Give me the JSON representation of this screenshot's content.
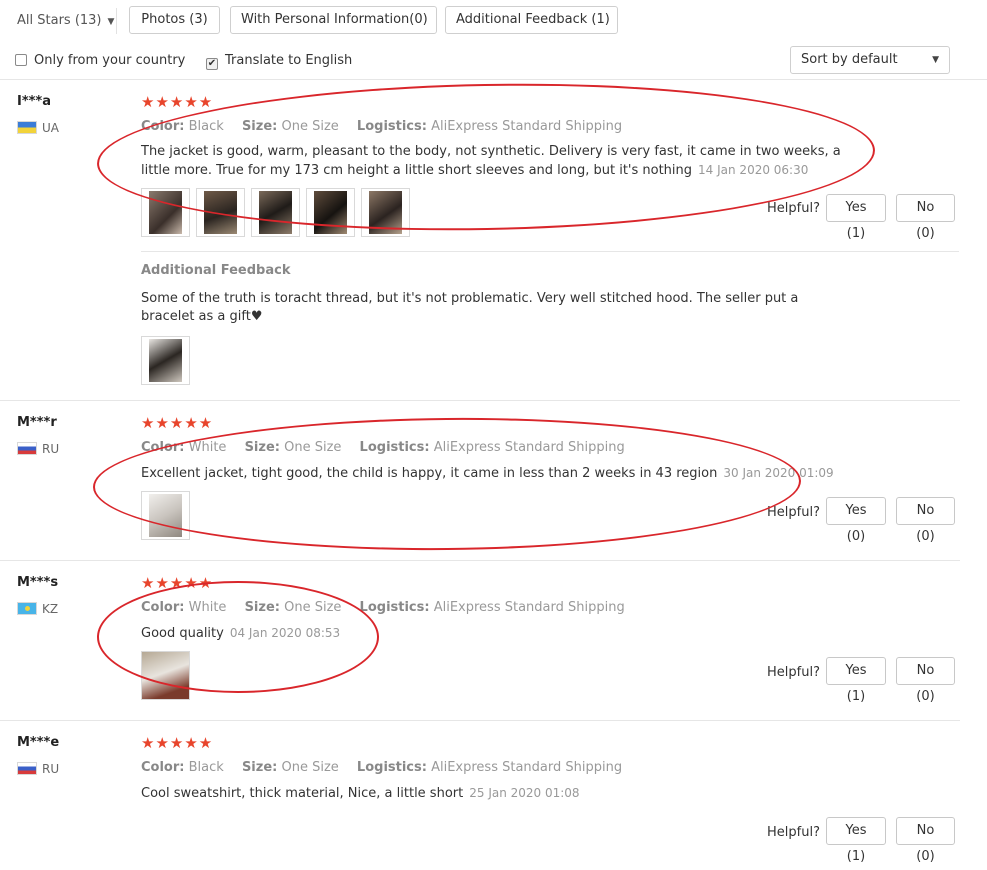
{
  "filters": {
    "all_stars": "All Stars (13)",
    "tabs": [
      "Photos (3)",
      "With Personal Information(0)",
      "Additional Feedback (1)"
    ],
    "only_country": "Only from your country",
    "translate": "Translate to English",
    "translate_checked": true,
    "sort": "Sort by default"
  },
  "labels": {
    "color": "Color:",
    "size": "Size:",
    "logistics": "Logistics:",
    "helpful": "Helpful?",
    "additional_feedback": "Additional Feedback",
    "star_glyphs": "★★★★★"
  },
  "reviews": [
    {
      "user": "I***a",
      "country": "UA",
      "rating": 5,
      "color": "Black",
      "size": "One Size",
      "logistics": "AliExpress Standard Shipping",
      "text": "The jacket is good, warm, pleasant to the body, not synthetic. Delivery is very fast, it came in two weeks, a little more. True for my 173 cm height a little short sleeves and long, but it's nothing",
      "date": "14 Jan 2020 06:30",
      "yes": "Yes (1)",
      "no": "No (0)",
      "additional_text": "Some of the truth is toracht thread, but it's not problematic. Very well stitched hood. The seller put a bracelet as a gift♥"
    },
    {
      "user": "M***r",
      "country": "RU",
      "rating": 5,
      "color": "White",
      "size": "One Size",
      "logistics": "AliExpress Standard Shipping",
      "text": "Excellent jacket, tight good, the child is happy, it came in less than 2 weeks in 43 region",
      "date": "30 Jan 2020 01:09",
      "yes": "Yes (0)",
      "no": "No (0)"
    },
    {
      "user": "M***s",
      "country": "KZ",
      "rating": 5,
      "color": "White",
      "size": "One Size",
      "logistics": "AliExpress Standard Shipping",
      "text": "Good quality",
      "date": "04 Jan 2020 08:53",
      "yes": "Yes (1)",
      "no": "No (0)"
    },
    {
      "user": "M***e",
      "country": "RU",
      "rating": 5,
      "color": "Black",
      "size": "One Size",
      "logistics": "AliExpress Standard Shipping",
      "text": "Cool sweatshirt, thick material, Nice, a little short",
      "date": "25 Jan 2020 01:08",
      "yes": "Yes (1)",
      "no": "No (0)"
    }
  ],
  "colors": {
    "accent": "#e8452c",
    "annotation": "#d9262b"
  }
}
